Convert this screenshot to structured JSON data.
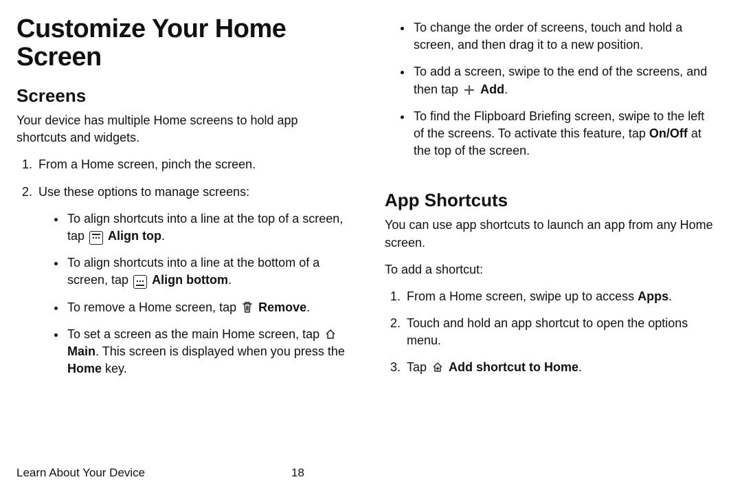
{
  "title": "Customize Your Home Screen",
  "left": {
    "h2": "Screens",
    "intro": "Your device has multiple Home screens to hold app shortcuts and widgets.",
    "step1": "From a Home screen, pinch the screen.",
    "step2": "Use these options to manage screens:",
    "b1a": "To align shortcuts into a line at the top of a screen, tap ",
    "b1b": "Align top",
    "b1c": ".",
    "b2a": "To align shortcuts into a line at the bottom of a screen, tap ",
    "b2b": "Align bottom",
    "b2c": ".",
    "b3a": "To remove a Home screen, tap ",
    "b3b": "Remove",
    "b3c": ".",
    "b4a": "To set a screen as the main Home screen, tap ",
    "b4b": "Main",
    "b4c": ". This screen is displayed when you press the ",
    "b4d": "Home",
    "b4e": " key."
  },
  "right": {
    "t1": "To change the order of screens, touch and hold a screen, and then drag it to a new position.",
    "t2a": "To add a screen, swipe to the end of the screens, and then tap ",
    "t2b": "Add",
    "t2c": ".",
    "t3a": "To find the Flipboard Briefing screen, swipe to the left of the screens. To activate this feature, tap ",
    "t3b": "On/Off",
    "t3c": " at the top of the screen.",
    "h2": "App Shortcuts",
    "intro": "You can use app shortcuts to launch an app from any Home screen.",
    "lead": "To add a shortcut:",
    "s1a": "From a Home screen, swipe up to access ",
    "s1b": "Apps",
    "s1c": ".",
    "s2": "Touch and hold an app shortcut to open the options menu.",
    "s3a": "Tap ",
    "s3b": "Add shortcut to Home",
    "s3c": "."
  },
  "footer": {
    "section": "Learn About Your Device",
    "page": "18"
  }
}
